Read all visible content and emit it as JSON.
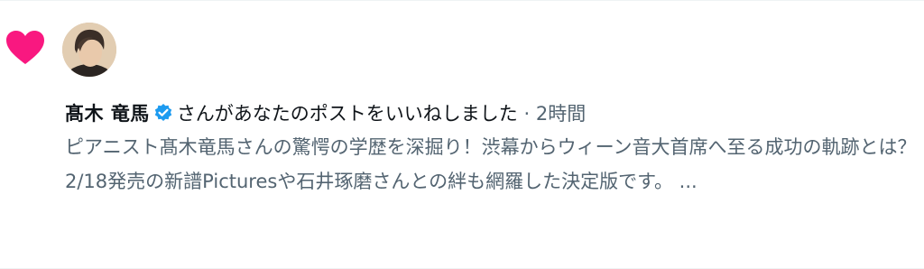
{
  "notification": {
    "type_icon": "heart-icon",
    "accent_color": "#f91880",
    "user": {
      "name": "髙木 竜馬",
      "verified_color": "#1d9bf0"
    },
    "action_text": "さんがあなたのポストをいいねしました",
    "separator": " · ",
    "time": "2時間",
    "post_preview": "ピアニスト髙木竜馬さんの驚愕の学歴を深掘り！渋幕からウィーン音大首席へ至る成功の軌跡とは？2/18発売の新譜Picturesや石井琢磨さんとの絆も網羅した決定版です。 ..."
  }
}
